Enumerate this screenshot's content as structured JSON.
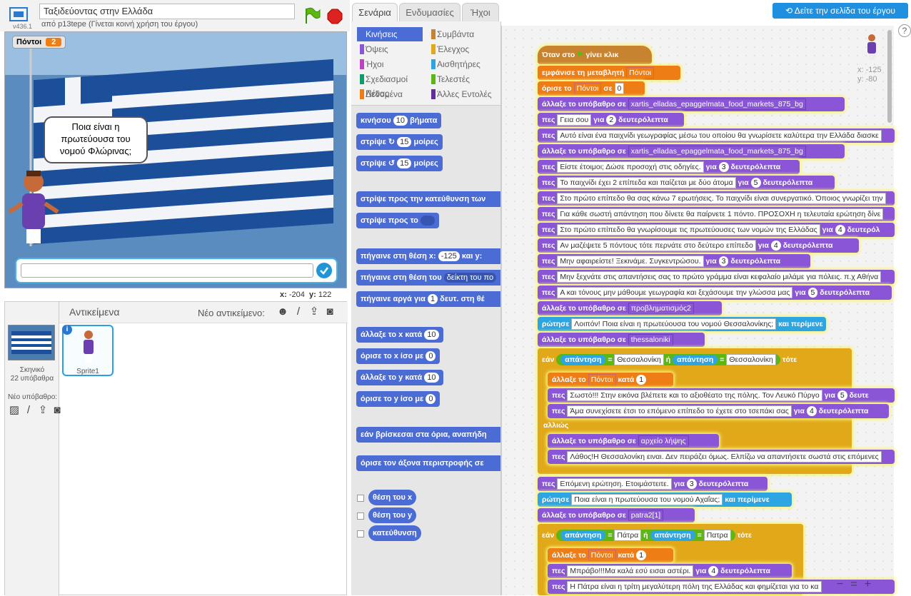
{
  "header": {
    "version": "v436.1",
    "project_title": "Ταξιδεύοντας στην Ελλάδα",
    "author": "από p13tepe (Γίνεται κοινή χρήση του έργου)"
  },
  "stage": {
    "variable_name": "Πόντοι",
    "variable_value": "2",
    "speech": "Ποια είναι η πρωτεύουσα του νομού Φλώρινας;",
    "mouse_x_label": "x:",
    "mouse_x": "-204",
    "mouse_y_label": "y:",
    "mouse_y": "122"
  },
  "sprites_pane": {
    "title": "Αντικείμενα",
    "new_sprite_label": "Νέο αντικείμενο:",
    "stage_label": "Σκηνικό",
    "stage_backdrops": "22 υπόβαθρα",
    "new_backdrop_label": "Νέο υπόβαθρο:",
    "sprite1_name": "Sprite1",
    "info_icon": "i"
  },
  "tabs": [
    "Σενάρια",
    "Ενδυμασίες",
    "Ήχοι"
  ],
  "see_project_button": "Δείτε την σελίδα του έργου",
  "help": "?",
  "categories_left": [
    "Κινήσεις",
    "Όψεις",
    "Ήχοι",
    "Σχεδιασμοί Πένας",
    "Δεδομένα"
  ],
  "categories_right": [
    "Συμβάντα",
    "Έλεγχος",
    "Αισθητήρες",
    "Τελεστές",
    "Άλλες Εντολές"
  ],
  "category_colors": [
    "#4a6cd4",
    "#8a55d7",
    "#bb42c3",
    "#0e9a6c",
    "#ee7d16",
    "#c88330",
    "#e1a91a",
    "#2ca5e2",
    "#5cb712",
    "#632d99"
  ],
  "palette": {
    "move": [
      "κινήσου",
      "10",
      "βήματα"
    ],
    "turn_right": [
      "στρίψε",
      "15",
      "μοίρες"
    ],
    "turn_left": [
      "στρίψε",
      "15",
      "μοίρες"
    ],
    "point_dir": "στρίψε προς την κατεύθυνση των",
    "point_to": "στρίψε προς το",
    "goto_xy": [
      "πήγαινε στη θέση x:",
      "-125",
      "και y:"
    ],
    "goto_obj": [
      "πήγαινε στη θέση του",
      "δείκτη του πο"
    ],
    "glide": [
      "πήγαινε αργά για",
      "1",
      "δευτ. στη θέ"
    ],
    "change_x": [
      "άλλαξε το x κατά",
      "10"
    ],
    "set_x": [
      "όρισε το x ίσο με",
      "0"
    ],
    "change_y": [
      "άλλαξε το y κατά",
      "10"
    ],
    "set_y": [
      "όρισε το y ίσο με",
      "0"
    ],
    "bounce": "εάν βρίσκεσαι στα όρια, αναπήδη",
    "rotation": "όρισε τον άξονα περιστροφής σε",
    "rep_x": "θέση του x",
    "rep_y": "θέση του y",
    "rep_dir": "κατεύθυνση"
  },
  "script": {
    "hat": "Όταν στο",
    "hat2": "γίνει κλικ",
    "l1": [
      "εμφάνισε τη μεταβλητή",
      "Πόντοι"
    ],
    "l2": [
      "όρισε το",
      "Πόντοι",
      "σε",
      "0"
    ],
    "bg1": [
      "άλλαξε το υπόβαθρο σε",
      "xartis_elladas_epaggelmata_food_markets_875_bg"
    ],
    "say1": [
      "πες",
      "Γεια σου",
      "για",
      "2",
      "δευτερόλεπτα"
    ],
    "say2": [
      "πες",
      "Αυτό είναι ένα παιχνίδι γεωγραφίας μέσω του οποίου θα γνωρίσετε καλύτερα την Ελλάδα διασκε"
    ],
    "bg2": [
      "άλλαξε το υπόβαθρο σε",
      "xartis_elladas_epaggelmata_food_markets_875_bg"
    ],
    "say3": [
      "πες",
      "Είστε έτοιμοι; Δώσε προσοχή στις οδηγίες.",
      "για",
      "3",
      "δευτερόλεπτα"
    ],
    "say4": [
      "πες",
      "Το παιχνίδι έχει 2 επίπεδα και παίζεται με δύο άτομα",
      "για",
      "5",
      "δευτερόλεπτα"
    ],
    "say5": [
      "πες",
      "Στο πρώτο επίπεδο θα σας κάνω 7 ερωτήσεις. Το παιχνίδι είναι συνεργατικό. Όποιος γνωρίζει την"
    ],
    "say6": [
      "πες",
      "Για κάθε σωστή απάντηση που δίνετε θα παίρνετε 1 πόντο. ΠΡΟΣΟΧΗ η τελευταία ερώτηση δίνε"
    ],
    "say7": [
      "πες",
      "Στο πρώτο επίπεδο θα γνωρίσουμε τις πρωτεύουσες των νομών της Ελλάδας",
      "για",
      "4",
      "δευτερόλ"
    ],
    "say8": [
      "πες",
      "Αν μαζέψετε 5 πόντους τότε περνάτε στο δεύτερο επίπεδο",
      "για",
      "4",
      "δευτερόλεπτα"
    ],
    "say9": [
      "πες",
      "Μην αφαιρείστε! Ξεκινάμε. Συγκεντρώσου.",
      "για",
      "3",
      "δευτερόλεπτα"
    ],
    "say10": [
      "πες",
      "Μην ξεχνάτε στις απαντήσεις σας το πρώτο γράμμα είναι κεφαλαίο μιλάμε για πόλεις. π.χ Αθήνα"
    ],
    "say11": [
      "πες",
      "Α και τόνους μην μάθουμε γεωγραφία και ξεχάσουμε την γλώσσα μας",
      "για",
      "5",
      "δευτερόλεπτα"
    ],
    "bg3": [
      "άλλαξε το υπόβαθρο σε",
      "προβληματισμός2"
    ],
    "ask1": [
      "ρώτησε",
      "Λοιπόν! Ποια είναι η πρωτεύουσα του νομού Θεσσαλονίκης;",
      "και περίμενε"
    ],
    "bg4": [
      "άλλαξε το υπόβαθρο σε",
      "thessaloniki"
    ],
    "if1": [
      "εάν",
      "απάντηση",
      "=",
      "Θεσσαλονίκη",
      "ή",
      "απάντηση",
      "=",
      "Θεσσαλονίκη",
      "τότε"
    ],
    "ch1": [
      "άλλαξε το",
      "Πόντοι",
      "κατά",
      "1"
    ],
    "say12": [
      "πες",
      "Σωστό!!! Στην εικόνα βλέπετε και το αξιοθέατο της πόλης. Τον Λευκό Πύργο",
      "για",
      "5",
      "δευτε"
    ],
    "say13": [
      "πες",
      "Άμα συνεχίσετε έτσι το επόμενο επίπεδο το έχετε στο τσεπάκι σας",
      "για",
      "4",
      "δευτερόλεπτα"
    ],
    "else": "αλλιώς",
    "bg5": [
      "άλλαξε το υπόβαθρο σε",
      "αρχείο λήψης"
    ],
    "say14": [
      "πες",
      "Λάθος!Η Θεσσαλονίκη ειναι. Δεν πειράζει όμως. Ελπίζω να απαντήσετε σωστά στις επόμενες"
    ],
    "say15": [
      "πες",
      "Επόμενη ερώτηση. Ετοιμάστειτε.",
      "για",
      "3",
      "δευτερόλεπτα"
    ],
    "ask2": [
      "ρώτησε",
      "Ποια είναι η πρωτεύουσα του νομού Αχαΐας;",
      "και περίμενε"
    ],
    "bg6": [
      "άλλαξε το υπόβαθρο σε",
      "patra2[1]"
    ],
    "if2": [
      "εάν",
      "απάντηση",
      "=",
      "Πάτρα",
      "ή",
      "απάντηση",
      "=",
      "Πατρα",
      "τότε"
    ],
    "ch2": [
      "άλλαξε το",
      "Πόντοι",
      "κατά",
      "1"
    ],
    "say16": [
      "πες",
      "Μπράβο!!!Μα καλά εσύ εισαι αστέρι.",
      "για",
      "4",
      "δευτερόλεπτα"
    ],
    "say17": [
      "πες",
      "Η Πάτρα είναι η τρίτη μεγαλύτερη πόλη της Ελλάδας και φημίζεται για το κα"
    ]
  },
  "mini": {
    "x": "x: -125",
    "y": "y: -80"
  },
  "zoom": [
    "−",
    "=",
    "+"
  ]
}
